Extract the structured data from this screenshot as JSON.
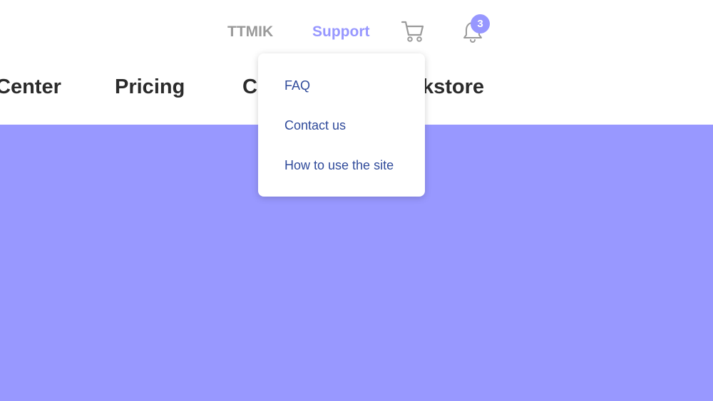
{
  "colors": {
    "accent": "#9797ff",
    "muted": "#9a9a9a",
    "dropdown_text": "#2f4a9a",
    "hero_bg": "#9898ff"
  },
  "top_nav": {
    "ttmik_label": "TTMIK",
    "support_label": "Support",
    "cart_icon": "shopping-cart",
    "bell_icon": "bell",
    "notification_count": "3"
  },
  "main_nav": {
    "items": [
      {
        "label": "Center"
      },
      {
        "label": "Pricing"
      },
      {
        "label": "C"
      },
      {
        "label": "kstore"
      }
    ]
  },
  "support_dropdown": {
    "items": [
      {
        "label": "FAQ"
      },
      {
        "label": "Contact us"
      },
      {
        "label": "How to use the site"
      }
    ]
  }
}
